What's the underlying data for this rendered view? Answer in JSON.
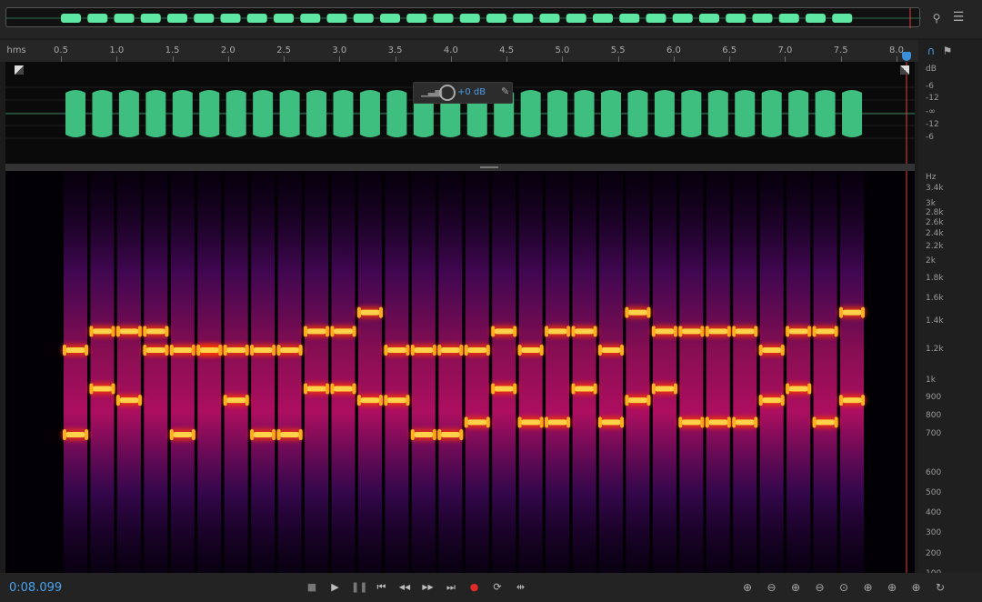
{
  "ruler": {
    "unit_label": "hms",
    "ticks": [
      "0.5",
      "1.0",
      "1.5",
      "2.0",
      "2.5",
      "3.0",
      "3.5",
      "4.0",
      "4.5",
      "5.0",
      "5.5",
      "6.0",
      "6.5",
      "7.0",
      "7.5",
      "8.0"
    ]
  },
  "db_scale": {
    "title": "dB",
    "labels": [
      "-6",
      "-12",
      "-∞",
      "-12",
      "-6"
    ]
  },
  "hz_scale": {
    "title": "Hz",
    "labels": [
      "3.4k",
      "3k",
      "2.8k",
      "2.6k",
      "2.4k",
      "2.2k",
      "2k",
      "1.8k",
      "1.6k",
      "1.4k",
      "1.2k",
      "1k",
      "900",
      "800",
      "700",
      "600",
      "500",
      "400",
      "300",
      "200",
      "100"
    ]
  },
  "hud": {
    "volume": "+0 dB"
  },
  "time_display": "0:08.099",
  "transport_icons": [
    "stop-icon",
    "play-icon",
    "pause-icon",
    "skip-back-icon",
    "rewind-icon",
    "fast-forward-icon",
    "skip-forward-icon",
    "record-icon",
    "loop-icon",
    "skip-selection-icon"
  ],
  "zoom_icons": [
    "zoom-in-amplitude-icon",
    "zoom-out-amplitude-icon",
    "zoom-in-time-icon",
    "zoom-out-time-icon",
    "zoom-full-icon",
    "zoom-in-left-icon",
    "zoom-in-right-icon",
    "zoom-selection-icon",
    "zoom-reset-icon"
  ],
  "colors": {
    "wave": "#3fbf7f",
    "overview_clip": "#5ee6a3",
    "playhead": "#e04040",
    "accent": "#3a8fd8"
  },
  "chart_data": {
    "type": "heatmap",
    "tone_count": 30,
    "low_tones_hz": [
      700,
      950,
      880,
      1200,
      700,
      1200,
      880,
      700,
      700,
      950,
      950,
      880,
      880,
      700,
      700,
      760,
      950,
      760,
      760,
      950,
      760,
      880,
      950,
      760,
      760,
      760,
      880,
      950,
      760,
      880
    ],
    "high_tones_hz": [
      1200,
      1330,
      1330,
      1330,
      1200,
      1200,
      1200,
      1200,
      1200,
      1330,
      1330,
      1480,
      1200,
      1200,
      1200,
      1200,
      1330,
      1200,
      1330,
      1330,
      1200,
      1480,
      1330,
      1330,
      1330,
      1330,
      1200,
      1330,
      1330,
      1480
    ]
  }
}
